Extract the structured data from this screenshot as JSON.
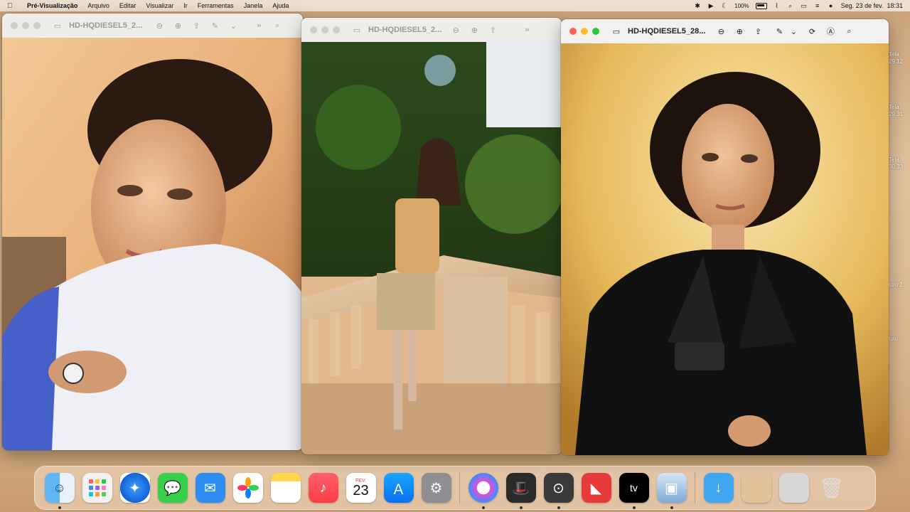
{
  "menubar": {
    "app_name": "Pré-Visualização",
    "menus": [
      "Arquivo",
      "Editar",
      "Visualizar",
      "Ir",
      "Ferramentas",
      "Janela",
      "Ajuda"
    ],
    "battery": "100%",
    "datetime": "Seg. 23 de fev.  18:31"
  },
  "desktop": {
    "labels": [
      "Tela\n29.12",
      "Tela\n29.31",
      "Tela\n30.33",
      "tulo 2",
      "tulo"
    ]
  },
  "windows": [
    {
      "title": "HD-HQDIESEL5_2..."
    },
    {
      "title": "HD-HQDIESEL5_2..."
    },
    {
      "title": "HD-HQDIESEL5_28..."
    }
  ],
  "dock": {
    "calendar_month": "FEV.",
    "calendar_day": "23",
    "tv_label": "tv",
    "apps": [
      "Finder",
      "Launchpad",
      "Safari",
      "Mensagens",
      "Mail",
      "Fotos",
      "Notas",
      "Música",
      "Calendário",
      "App Store",
      "Ajustes do Sistema",
      "iTunes",
      "Alfred",
      "Camo",
      "Bear",
      "Apple TV",
      "Pré-Visualização",
      "Transferências",
      "Imagens",
      "Captura",
      "Lixo"
    ]
  },
  "colors": {
    "red": "#ff5f57",
    "yellow": "#febc2e",
    "green": "#28c840"
  }
}
